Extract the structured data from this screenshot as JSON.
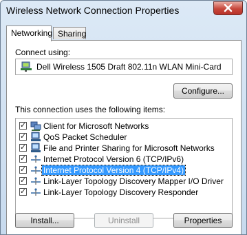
{
  "window": {
    "title": "Wireless Network Connection Properties"
  },
  "tabs": [
    {
      "label": "Networking",
      "active": true
    },
    {
      "label": "Sharing",
      "active": false
    }
  ],
  "connect_using": {
    "label": "Connect using:",
    "adapter": "Dell Wireless 1505 Draft 802.11n WLAN Mini-Card",
    "configure_button": "Configure..."
  },
  "items_section": {
    "label": "This connection uses the following items:",
    "items": [
      {
        "label": "Client for Microsoft Networks",
        "checked": true,
        "icon": "network-client-icon"
      },
      {
        "label": "QoS Packet Scheduler",
        "checked": true,
        "icon": "network-service-icon"
      },
      {
        "label": "File and Printer Sharing for Microsoft Networks",
        "checked": true,
        "icon": "network-service-icon"
      },
      {
        "label": "Internet Protocol Version 6 (TCP/IPv6)",
        "checked": true,
        "icon": "protocol-icon"
      },
      {
        "label": "Internet Protocol Version 4 (TCP/IPv4)",
        "checked": true,
        "icon": "protocol-icon",
        "selected": true
      },
      {
        "label": "Link-Layer Topology Discovery Mapper I/O Driver",
        "checked": true,
        "icon": "protocol-icon"
      },
      {
        "label": "Link-Layer Topology Discovery Responder",
        "checked": true,
        "icon": "protocol-icon"
      }
    ]
  },
  "buttons": {
    "install": "Install...",
    "uninstall": "Uninstall",
    "properties": "Properties"
  },
  "colors": {
    "selection": "#3399ff",
    "title_bar": "#c7daee",
    "close_button": "#c7463a"
  }
}
